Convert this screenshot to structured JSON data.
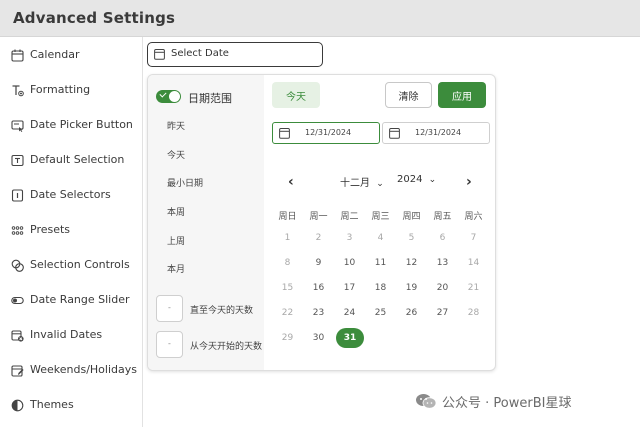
{
  "window": {
    "title": "Advanced Settings"
  },
  "sidebar": {
    "items": [
      {
        "label": "Calendar",
        "icon": "calendar-icon"
      },
      {
        "label": "Formatting",
        "icon": "text-format-icon"
      },
      {
        "label": "Date Picker Button",
        "icon": "picker-button-icon"
      },
      {
        "label": "Default Selection",
        "icon": "default-selection-icon"
      },
      {
        "label": "Date Selectors",
        "icon": "selector-icon"
      },
      {
        "label": "Presets",
        "icon": "grid-dots-icon"
      },
      {
        "label": "Selection Controls",
        "icon": "selection-controls-icon"
      },
      {
        "label": "Date Range Slider",
        "icon": "toggle-slider-icon"
      },
      {
        "label": "Invalid Dates",
        "icon": "invalid-date-icon"
      },
      {
        "label": "Weekends/Holidays",
        "icon": "calendar-edit-icon"
      },
      {
        "label": "Themes",
        "icon": "half-circle-icon"
      }
    ]
  },
  "select_date": {
    "label": "Select Date"
  },
  "panel": {
    "toggle_label": "日期范围",
    "toggle_on": true,
    "range_items": [
      "昨天",
      "今天",
      "最小日期",
      "本周",
      "上周",
      "本月"
    ],
    "num_inputs": [
      {
        "value": "-",
        "label": "直至今天的天数"
      },
      {
        "value": "-",
        "label": "从今天开始的天数"
      }
    ],
    "buttons": {
      "today": "今天",
      "clear": "清除",
      "apply": "应用"
    },
    "start_date": "12/31/2024",
    "end_date": "12/31/2024",
    "nav": {
      "prev": "‹",
      "next": "›",
      "month": "十二月",
      "year": "2024",
      "chevron": "⌄"
    },
    "weekdays": [
      "周日",
      "周一",
      "周二",
      "周三",
      "周四",
      "周五",
      "周六"
    ],
    "weeks": [
      [
        "1",
        "2",
        "3",
        "4",
        "5",
        "6",
        "7"
      ],
      [
        "8",
        "9",
        "10",
        "11",
        "12",
        "13",
        "14"
      ],
      [
        "15",
        "16",
        "17",
        "18",
        "19",
        "20",
        "21"
      ],
      [
        "22",
        "23",
        "24",
        "25",
        "26",
        "27",
        "28"
      ],
      [
        "29",
        "30",
        "31"
      ]
    ],
    "selected_day": "31"
  },
  "watermark": {
    "text": "公众号 · PowerBI星球"
  },
  "colors": {
    "accent": "#3c8c3c",
    "accent_light": "#e6f1e4",
    "titlebar": "#e6e6e6"
  }
}
